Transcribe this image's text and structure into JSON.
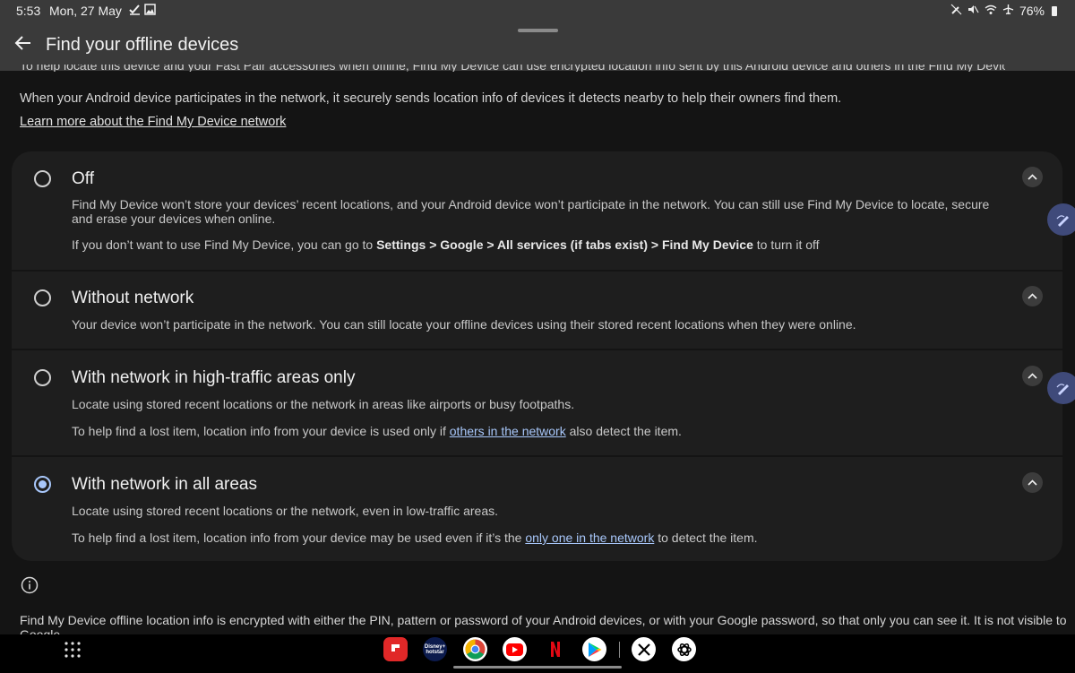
{
  "status_bar": {
    "time": "5:53",
    "date": "Mon, 27 May",
    "battery": "76%"
  },
  "app_bar": {
    "title": "Find your offline devices"
  },
  "intro": {
    "clipped_text": "To help locate this device and your Fast Pair accessories when offline, Find My Device can use encrypted location info sent by this Android device and others in the Find My Device network.",
    "text": "When your Android device participates in the network, it securely sends location info of devices it detects nearby to help their owners find them.",
    "learn_more_link": "Learn more about the Find My Device network"
  },
  "options": [
    {
      "title": "Off",
      "checked": false,
      "desc1": "Find My Device won’t store your devices’ recent locations, and your Android device won’t participate in the network. You can still use Find My Device to locate, secure and erase your devices when online.",
      "desc2_pre": "If you don’t want to use Find My Device, you can go to ",
      "desc2_bold": "Settings > Google > All services (if tabs exist) > Find My Device",
      "desc2_post": " to turn it off"
    },
    {
      "title": "Without network",
      "checked": false,
      "desc1": "Your device won’t participate in the network. You can still locate your offline devices using their stored recent locations when they were online."
    },
    {
      "title": "With network in high-traffic areas only",
      "checked": false,
      "desc1": "Locate using stored recent locations or the network in areas like airports or busy footpaths.",
      "desc2_pre": "To help find a lost item, location info from your device is used only if ",
      "desc2_link": "others in the network",
      "desc2_post": " also detect the item."
    },
    {
      "title": "With network in all areas",
      "checked": true,
      "desc1": "Locate using stored recent locations or the network, even in low-traffic areas.",
      "desc2_pre": "To help find a lost item, location info from your device may be used even if it’s the ",
      "desc2_link": "only one in the network",
      "desc2_post": " to detect the item."
    }
  ],
  "footer": {
    "text": "Find My Device offline location info is encrypted with either the PIN, pattern or password of your Android devices, or with your Google password, so that only you can see it. It is not visible to Google."
  },
  "dock": {
    "apps": [
      {
        "icon": "flipboard-icon",
        "color": "#e12828"
      },
      {
        "icon": "disney-hotstar-icon",
        "color": "#0c1b4d",
        "label": "Disney+ hotstar"
      },
      {
        "icon": "chrome-icon",
        "color": "#ffffff"
      },
      {
        "icon": "youtube-icon",
        "color": "#ffffff"
      },
      {
        "icon": "netflix-icon",
        "color": "#000000"
      },
      {
        "icon": "play-store-icon",
        "color": "#ffffff"
      },
      {
        "icon": "x-icon",
        "color": "#ffffff"
      },
      {
        "icon": "chatgpt-icon",
        "color": "#ffffff"
      }
    ]
  },
  "colors": {
    "accent": "#a8c7fa",
    "background": "#141414",
    "card": "#1e1e1e",
    "app_bar": "#3a3a3a"
  }
}
